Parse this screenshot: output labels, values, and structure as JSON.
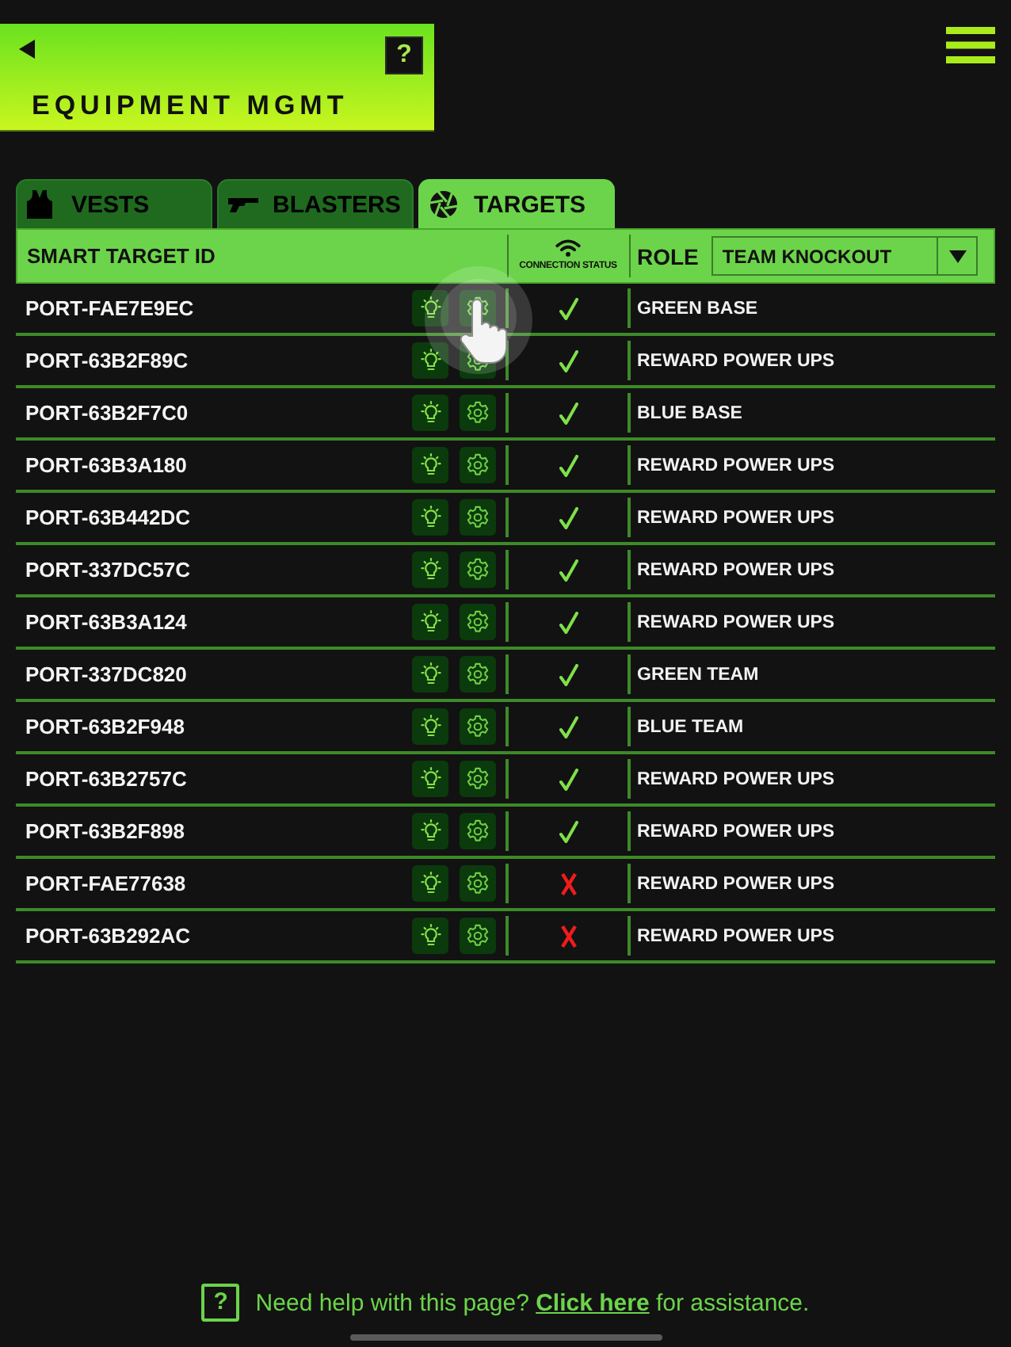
{
  "header": {
    "title": "EQUIPMENT MGMT",
    "help_label": "?"
  },
  "tabs": [
    {
      "label": "VESTS",
      "kind": "vest",
      "selected": false
    },
    {
      "label": "BLASTERS",
      "kind": "blaster",
      "selected": false
    },
    {
      "label": "TARGETS",
      "kind": "target",
      "selected": true
    }
  ],
  "table": {
    "columns": {
      "id": "SMART TARGET ID",
      "status": "CONNECTION STATUS",
      "role": "ROLE"
    },
    "role_filter": {
      "value": "TEAM KNOCKOUT"
    },
    "rows": [
      {
        "id": "PORT-FAE7E9EC",
        "connected": true,
        "role": "GREEN BASE"
      },
      {
        "id": "PORT-63B2F89C",
        "connected": true,
        "role": "REWARD POWER UPS"
      },
      {
        "id": "PORT-63B2F7C0",
        "connected": true,
        "role": "BLUE BASE"
      },
      {
        "id": "PORT-63B3A180",
        "connected": true,
        "role": "REWARD POWER UPS"
      },
      {
        "id": "PORT-63B442DC",
        "connected": true,
        "role": "REWARD POWER UPS"
      },
      {
        "id": "PORT-337DC57C",
        "connected": true,
        "role": "REWARD POWER UPS"
      },
      {
        "id": "PORT-63B3A124",
        "connected": true,
        "role": "REWARD POWER UPS"
      },
      {
        "id": "PORT-337DC820",
        "connected": true,
        "role": "GREEN TEAM"
      },
      {
        "id": "PORT-63B2F948",
        "connected": true,
        "role": "BLUE TEAM"
      },
      {
        "id": "PORT-63B2757C",
        "connected": true,
        "role": "REWARD POWER UPS"
      },
      {
        "id": "PORT-63B2F898",
        "connected": true,
        "role": "REWARD POWER UPS"
      },
      {
        "id": "PORT-FAE77638",
        "connected": false,
        "role": "REWARD POWER UPS"
      },
      {
        "id": "PORT-63B292AC",
        "connected": false,
        "role": "REWARD POWER UPS"
      }
    ]
  },
  "footer": {
    "help_label": "?",
    "text": "Need help with this page?",
    "link": "Click here",
    "text_after": "for assistance."
  }
}
